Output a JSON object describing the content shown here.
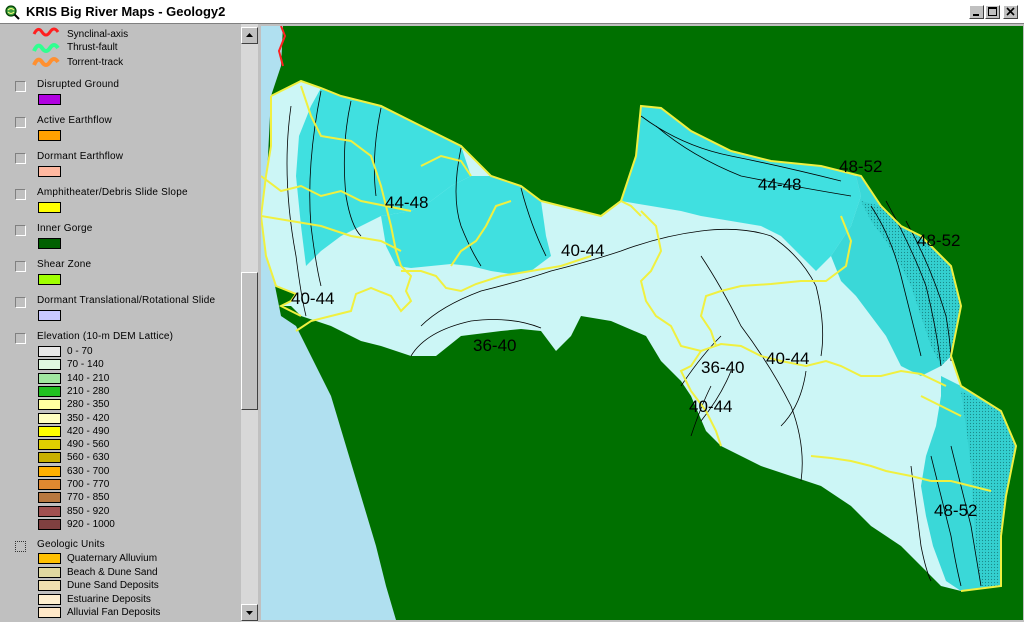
{
  "window": {
    "title": "KRIS Big River Maps - Geology2",
    "icon": "globe-magnifier-icon"
  },
  "legend": {
    "line_items": [
      {
        "label": "Synclinal-axis",
        "color": "#30ff90"
      },
      {
        "label": "Thrust-fault",
        "color": "#30ff90"
      },
      {
        "label": "Torrent-track",
        "color": "#ff9030"
      }
    ],
    "layers": [
      {
        "title": "Disrupted Ground",
        "color": "#b000e0"
      },
      {
        "title": "Active Earthflow",
        "color": "#ffa000"
      },
      {
        "title": "Dormant Earthflow",
        "color": "#ffb8a0"
      },
      {
        "title": "Amphitheater/Debris Slide Slope",
        "color": "#ffff00"
      },
      {
        "title": "Inner Gorge",
        "color": "#006000"
      },
      {
        "title": "Shear Zone",
        "color": "#a0ff00"
      },
      {
        "title": "Dormant Translational/Rotational Slide",
        "color": "#c8c8ff"
      }
    ],
    "elevation": {
      "title": "Elevation (10-m DEM Lattice)",
      "classes": [
        {
          "label": "0 - 70",
          "color": "#e8e8e8"
        },
        {
          "label": "70 - 140",
          "color": "#e0f8e0"
        },
        {
          "label": "140 - 210",
          "color": "#a0e8a0"
        },
        {
          "label": "210 - 280",
          "color": "#20c020"
        },
        {
          "label": "280 - 350",
          "color": "#ffffa0"
        },
        {
          "label": "350 - 420",
          "color": "#ffffc0"
        },
        {
          "label": "420 - 490",
          "color": "#ffff00"
        },
        {
          "label": "490 - 560",
          "color": "#e0d000"
        },
        {
          "label": "560 - 630",
          "color": "#c8b000"
        },
        {
          "label": "630 - 700",
          "color": "#ffb000"
        },
        {
          "label": "700 - 770",
          "color": "#e08830"
        },
        {
          "label": "770 - 850",
          "color": "#b87840"
        },
        {
          "label": "850 - 920",
          "color": "#a05050"
        },
        {
          "label": "920 - 1000",
          "color": "#804040"
        }
      ]
    },
    "geologic_units": {
      "title": "Geologic Units",
      "classes": [
        {
          "label": "Quaternary Alluvium",
          "color": "#ffc000"
        },
        {
          "label": "Beach & Dune Sand",
          "color": "#e0d8a0"
        },
        {
          "label": "Dune Sand Deposits",
          "color": "#f0e0b0"
        },
        {
          "label": "Estuarine Deposits",
          "color": "#fff0d0"
        },
        {
          "label": "Alluvial Fan Deposits",
          "color": "#ffe8c8"
        }
      ]
    }
  },
  "map": {
    "colors": {
      "forest": "#007000",
      "ocean": "#b0e0f0",
      "light_zone": "#ccf6f6",
      "mid_zone": "#40e0e0",
      "dark_zone": "#30c8c8",
      "boundary": "#f0f040",
      "contour": "#000000"
    },
    "labels": [
      "44-48",
      "44-48",
      "48-52",
      "48-52",
      "40-44",
      "40-44",
      "36-40",
      "36-40",
      "40-44",
      "40-44",
      "48-52"
    ]
  }
}
